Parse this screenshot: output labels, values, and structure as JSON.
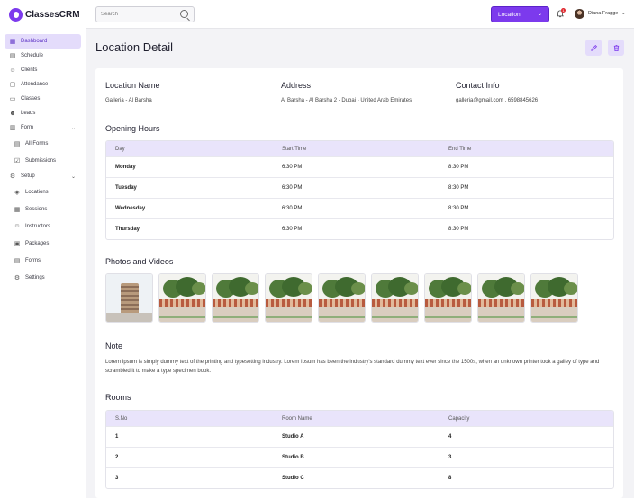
{
  "app": {
    "name": "ClassesCRM"
  },
  "sidebar": {
    "items": [
      {
        "label": "Dashboard",
        "icon": "grid-icon",
        "active": true
      },
      {
        "label": "Schedule",
        "icon": "calendar-icon"
      },
      {
        "label": "Clients",
        "icon": "users-icon"
      },
      {
        "label": "Attendance",
        "icon": "clipboard-icon"
      },
      {
        "label": "Classes",
        "icon": "book-icon"
      },
      {
        "label": "Leads",
        "icon": "user-icon"
      },
      {
        "label": "Form",
        "icon": "form-icon",
        "expandable": true
      },
      {
        "label": "All Forms",
        "icon": "list-icon",
        "sub": true
      },
      {
        "label": "Submissions",
        "icon": "check-icon",
        "sub": true
      },
      {
        "label": "Setup",
        "icon": "setup-icon",
        "expandable": true
      },
      {
        "label": "Locations",
        "icon": "location-icon",
        "sub": true
      },
      {
        "label": "Sessions",
        "icon": "sessions-icon",
        "sub": true
      },
      {
        "label": "Instructors",
        "icon": "instructor-icon",
        "sub": true
      },
      {
        "label": "Packages",
        "icon": "package-icon",
        "sub": true
      },
      {
        "label": "Forms",
        "icon": "forms-icon",
        "sub": true
      },
      {
        "label": "Settings",
        "icon": "gear-icon",
        "sub": true
      }
    ]
  },
  "header": {
    "search_placeholder": "Search",
    "location_label": "Location",
    "notification_count": "1",
    "user_name": "Diana Fragge"
  },
  "page": {
    "title": "Location Detail"
  },
  "details": {
    "name_heading": "Location Name",
    "name_value": "Galleria - Al Barsha",
    "address_heading": "Address",
    "address_value": "Al Barsha - Al Barsha 2 - Dubai - United Arab Emirates",
    "contact_heading": "Contact Info",
    "contact_value": "galleria@gmail.com , 6598845626"
  },
  "opening_hours": {
    "heading": "Opening Hours",
    "columns": [
      "Day",
      "Start Time",
      "End Time"
    ],
    "rows": [
      [
        "Monday",
        "6:30 PM",
        "8:30 PM"
      ],
      [
        "Tuesday",
        "6:30 PM",
        "8:30 PM"
      ],
      [
        "Wednesday",
        "6:30 PM",
        "8:30 PM"
      ],
      [
        "Thursday",
        "6:30 PM",
        "8:30 PM"
      ]
    ]
  },
  "media": {
    "heading": "Photos and Videos",
    "count": 9
  },
  "note": {
    "heading": "Note",
    "text": "Lorem Ipsum is simply dummy text of the printing and typesetting industry. Lorem Ipsum has been the industry's standard dummy text ever since the 1500s, when an unknown printer took a galley of type and scrambled it to make a type specimen book."
  },
  "rooms": {
    "heading": "Rooms",
    "columns": [
      "S.No",
      "Room Name",
      "Capacity"
    ],
    "rows": [
      [
        "1",
        "Studio A",
        "4"
      ],
      [
        "2",
        "Studio B",
        "3"
      ],
      [
        "3",
        "Studio C",
        "8"
      ]
    ]
  },
  "colors": {
    "accent": "#7c3aed",
    "accent_light": "#e4dcfb",
    "table_header": "#e9e4fb",
    "badge": "#e0282e"
  }
}
